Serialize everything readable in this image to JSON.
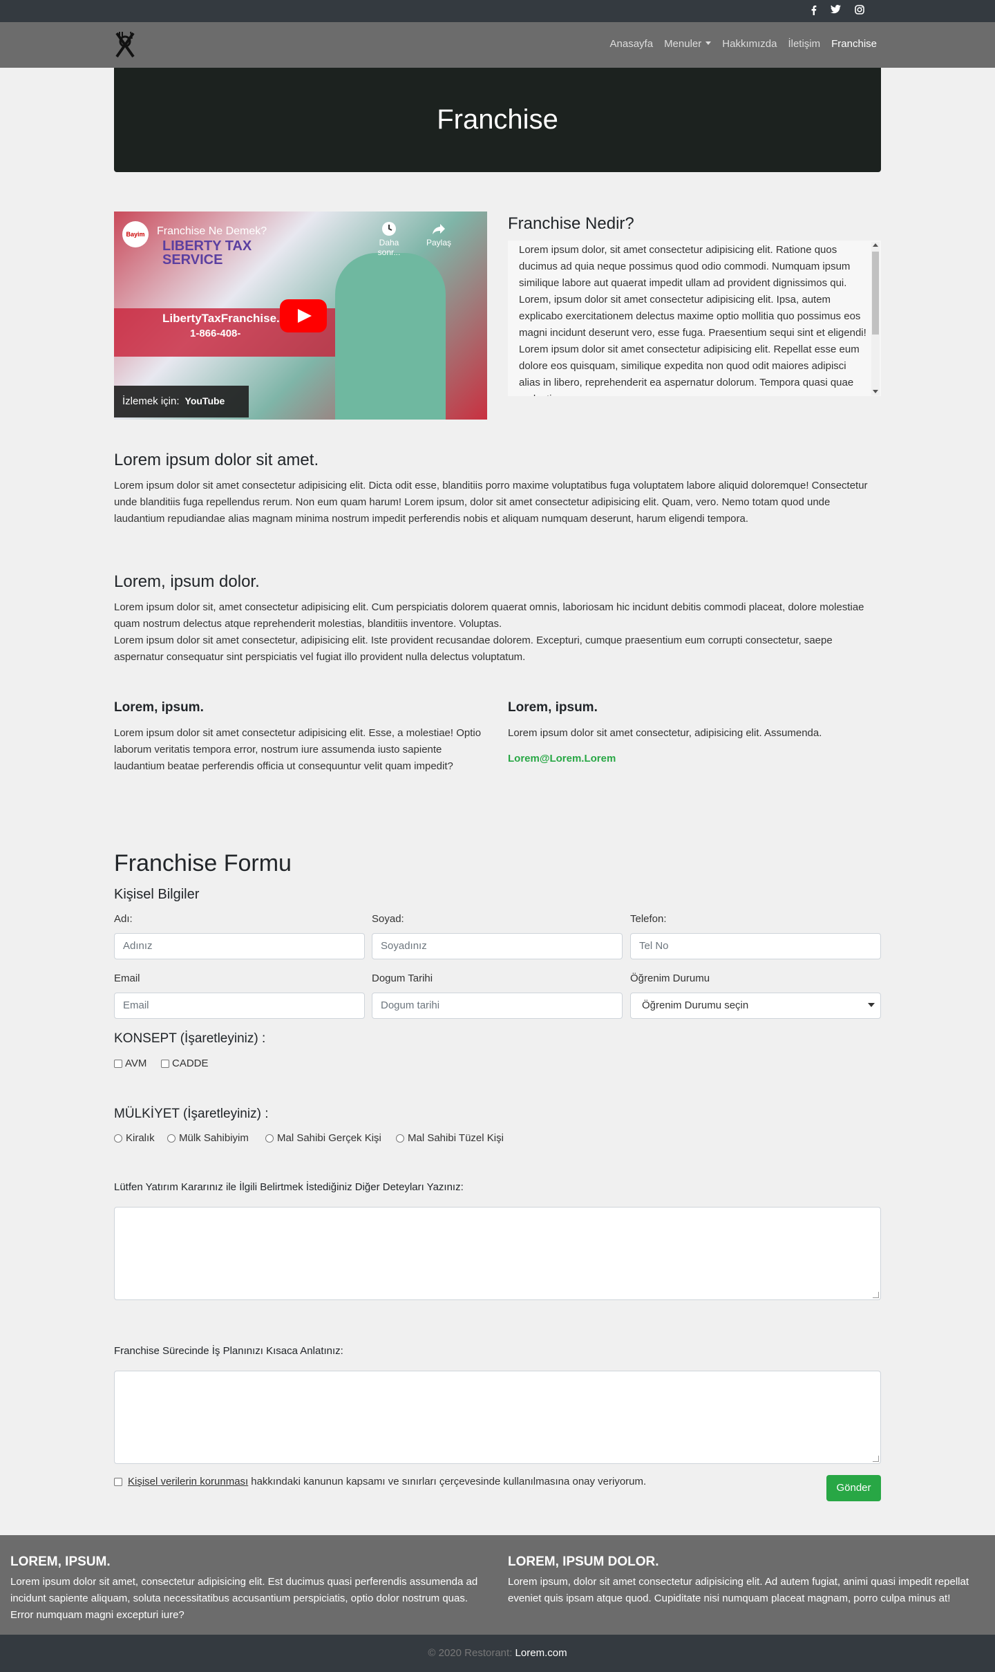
{
  "topbar": {
    "icons": [
      "facebook-icon",
      "twitter-icon",
      "instagram-icon"
    ]
  },
  "nav": {
    "logo": "restaurant-logo",
    "links": [
      "Anasayfa",
      "Menuler",
      "Hakkımızda",
      "İletişim",
      "Franchise"
    ],
    "active": "Franchise"
  },
  "hero": {
    "title": "Franchise"
  },
  "video": {
    "title": "Franchise Ne Demek?",
    "channel": "Bayim",
    "later": "Daha sonr...",
    "share": "Paylaş",
    "watch_on": "İzlemek için:",
    "yt": "YouTube",
    "sign_text": "LIBERTY TAX SERVICE",
    "site_text": "LibertyTaxFranchise.com",
    "phone_text": "1-866-408-"
  },
  "whatis": {
    "title": "Franchise Nedir?",
    "text": "Lorem ipsum dolor, sit amet consectetur adipisicing elit. Ratione quos ducimus ad quia neque possimus quod odio commodi. Numquam ipsum similique labore aut quaerat impedit ullam ad provident dignissimos qui. Lorem, ipsum dolor sit amet consectetur adipisicing elit. Ipsa, autem explicabo exercitationem delectus maxime optio mollitia quo possimus eos magni incidunt deserunt vero, esse fuga. Praesentium sequi sint et eligendi! Lorem ipsum dolor sit amet consectetur adipisicing elit. Repellat esse eum dolore eos quisquam, similique expedita non quod odit maiores adipisci alias in libero, reprehenderit ea aspernatur dolorum. Tempora quasi quae molestiae."
  },
  "section1": {
    "title": "Lorem ipsum dolor sit amet.",
    "text": "Lorem ipsum dolor sit amet consectetur adipisicing elit. Dicta odit esse, blanditiis porro maxime voluptatibus fuga voluptatem labore aliquid doloremque! Consectetur unde blanditiis fuga repellendus rerum. Non eum quam harum! Lorem ipsum, dolor sit amet consectetur adipisicing elit. Quam, vero. Nemo totam quod unde laudantium repudiandae alias magnam minima nostrum impedit perferendis nobis et aliquam numquam deserunt, harum eligendi tempora."
  },
  "section2": {
    "title": "Lorem, ipsum dolor.",
    "text1": "Lorem ipsum dolor sit, amet consectetur adipisicing elit. Cum perspiciatis dolorem quaerat omnis, laboriosam hic incidunt debitis commodi placeat, dolore molestiae quam nostrum delectus atque reprehenderit molestias, blanditiis inventore. Voluptas.",
    "text2": "Lorem ipsum dolor sit amet consectetur, adipisicing elit. Iste provident recusandae dolorem. Excepturi, cumque praesentium eum corrupti consectetur, saepe aspernatur consequatur sint perspiciatis vel fugiat illo provident nulla delectus voluptatum."
  },
  "col_left": {
    "title": "Lorem, ipsum.",
    "text": "Lorem ipsum dolor sit amet consectetur adipisicing elit. Esse, a molestiae! Optio laborum veritatis tempora error, nostrum iure assumenda iusto sapiente laudantium beatae perferendis officia ut consequuntur velit quam impedit?"
  },
  "col_right": {
    "title": "Lorem, ipsum.",
    "text": "Lorem ipsum dolor sit amet consectetur, adipisicing elit. Assumenda.",
    "email": "Lorem@Lorem.Lorem"
  },
  "form": {
    "title": "Franchise Formu",
    "subtitle": "Kişisel Bilgiler",
    "name_label": "Adı:",
    "name_ph": "Adınız",
    "surname_label": "Soyad:",
    "surname_ph": "Soyadınız",
    "phone_label": "Telefon:",
    "phone_ph": "Tel No",
    "email_label": "Email",
    "email_ph": "Email",
    "birth_label": "Dogum Tarihi",
    "birth_ph": "Dogum tarihi",
    "edu_label": "Öğrenim Durumu",
    "edu_value": "Öğrenim Durumu seçin",
    "concept_title": "KONSEPT (İşaretleyiniz) :",
    "concept_options": [
      "AVM",
      "CADDE"
    ],
    "ownership_title": "MÜLKİYET (İşaretleyiniz) :",
    "ownership_options": [
      "Kiralık",
      "Mülk Sahibiyim",
      "Mal Sahibi Gerçek Kişi",
      "Mal Sahibi Tüzel Kişi"
    ],
    "details_label": "Lütfen Yatırım Kararınız ile İlgili Belirtmek İstediğiniz Diğer Deteyları Yazınız:",
    "plan_label": "Franchise Sürecinde İş Planınızı Kısaca Anlatınız:",
    "consent_link": "Kişisel verilerin korunması",
    "consent_text": "hakkındaki kanunun kapsamı ve sınırları çerçevesinde kullanılmasına onay veriyorum.",
    "submit": "Gönder"
  },
  "footer": {
    "left_title": "LOREM, IPSUM.",
    "left_text": "Lorem ipsum dolor sit amet, consectetur adipisicing elit. Est ducimus quasi perferendis assumenda ad incidunt sapiente aliquam, soluta necessitatibus accusantium perspiciatis, optio dolor nostrum quas. Error numquam magni excepturi iure?",
    "right_title": "LOREM, IPSUM DOLOR.",
    "right_text": "Lorem ipsum, dolor sit amet consectetur adipisicing elit. Ad autem fugiat, animi quasi impedit repellat eveniet quis ipsam atque quod. Cupiditate nisi numquam placeat magnam, porro culpa minus at!",
    "copyright": "© 2020 Restorant:",
    "copyright_link": "Lorem.com"
  }
}
